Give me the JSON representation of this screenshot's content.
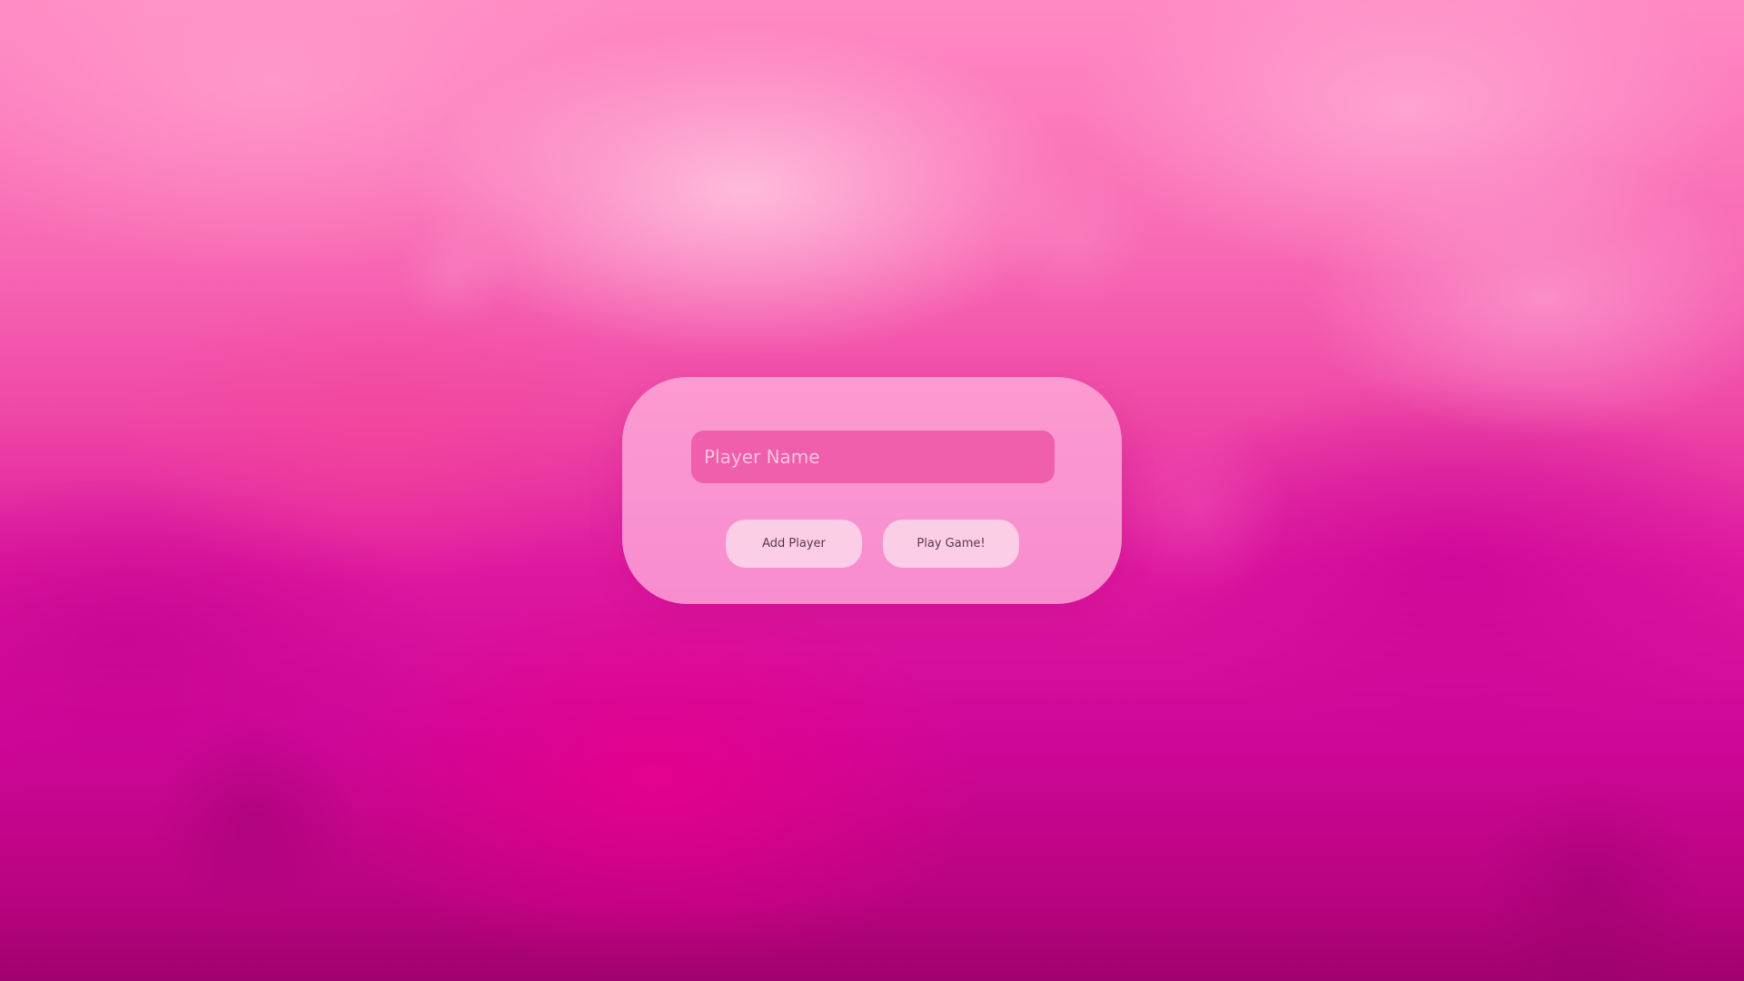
{
  "player_form": {
    "name_input": {
      "placeholder": "Player Name",
      "value": ""
    },
    "add_player_label": "Add Player",
    "play_game_label": "Play Game!"
  },
  "colors": {
    "background_top": "#ff8ac3",
    "background_bottom": "#a0026e",
    "card": "#ffb0dc",
    "input": "#f05fac",
    "button": "#fbd6e9"
  }
}
